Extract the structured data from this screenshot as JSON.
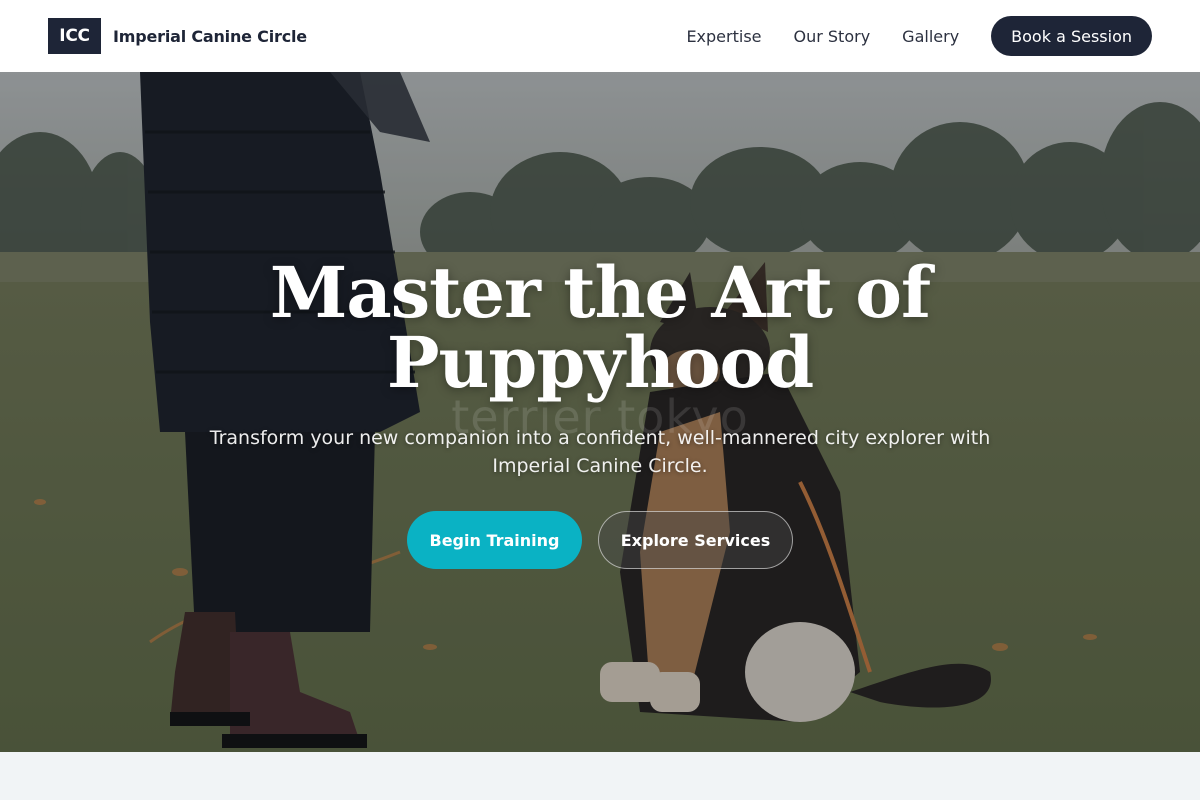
{
  "header": {
    "logo_text": "ICC",
    "brand_name": "Imperial Canine Circle",
    "nav": [
      {
        "label": "Expertise"
      },
      {
        "label": "Our Story"
      },
      {
        "label": "Gallery"
      }
    ],
    "cta_label": "Book a Session"
  },
  "hero": {
    "title_line1": "Master the Art of",
    "title_line2": "Puppyhood",
    "watermark": "terrier tokyo",
    "subtitle": "Transform your new companion into a confident, well-mannered city explorer with Imperial Canine Circle.",
    "primary_button": "Begin Training",
    "secondary_button": "Explore Services",
    "image_description_icon": "dog-training-photo"
  },
  "colors": {
    "navy": "#1e2537",
    "teal": "#0ab2c4",
    "page_bg": "#f1f4f6"
  }
}
